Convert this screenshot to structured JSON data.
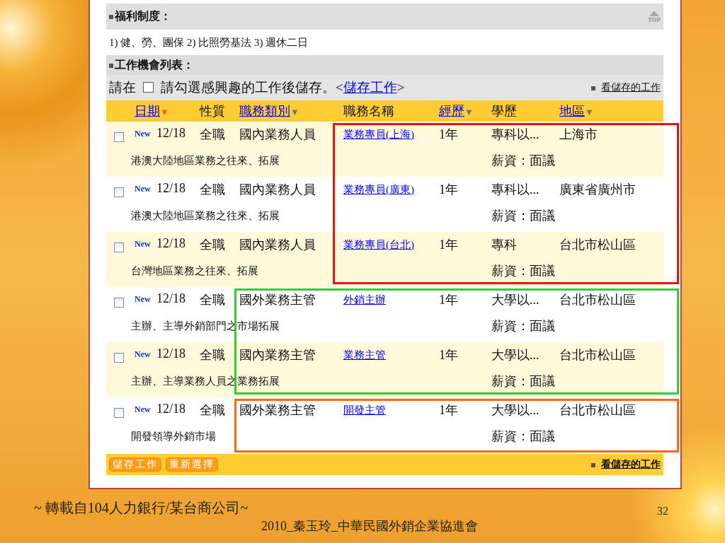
{
  "benefits": {
    "heading": "福利制度：",
    "text": "1) 健、勞、團保 2) 比照勞基法 3) 週休二日",
    "top_link": "TOP"
  },
  "jobs_heading": "工作機會列表：",
  "instruction": {
    "before": "請在",
    "checked": false,
    "after": "請勾選感興趣的工作後儲存。<",
    "link": "儲存工作",
    "end": ">",
    "saved_link": "看儲存的工作"
  },
  "columns": [
    {
      "label": "日期",
      "link": true,
      "arrow": "▼",
      "sorted": true
    },
    {
      "label": "性質",
      "link": false
    },
    {
      "label": "職務類別",
      "link": true,
      "arrow": "▼",
      "sorted": false
    },
    {
      "label": "職務名稱",
      "link": false
    },
    {
      "label": "經歷",
      "link": true,
      "arrow": "▼",
      "sorted": false
    },
    {
      "label": "學歷",
      "link": false
    },
    {
      "label": "地區",
      "link": true,
      "arrow": "▼",
      "sorted": false
    }
  ],
  "jobs": [
    {
      "checked": false,
      "badge": "New",
      "date": "12/18",
      "type": "全職",
      "category": "國內業務人員",
      "title": "業務專員(上海)",
      "experience": "1年",
      "education": "專科以...",
      "area": "上海市",
      "description": "港澳大陸地區業務之往來、拓展",
      "salary": "薪資：面議",
      "frame": {
        "color": "#ee1111",
        "kind": "narrow"
      }
    },
    {
      "checked": false,
      "badge": "New",
      "date": "12/18",
      "type": "全職",
      "category": "國內業務人員",
      "title": "業務專員(廣東)",
      "experience": "1年",
      "education": "專科以...",
      "area": "廣東省廣州市",
      "description": "港澳大陸地區業務之往來、拓展",
      "salary": "薪資：面議",
      "frame": {
        "color": "#ee1111",
        "kind": "narrow"
      }
    },
    {
      "checked": false,
      "badge": "New",
      "date": "12/18",
      "type": "全職",
      "category": "國內業務人員",
      "title": "業務專員(台北)",
      "experience": "1年",
      "education": "專科",
      "area": "台北市松山區",
      "description": "台灣地區業務之往來、拓展",
      "salary": "薪資：面議",
      "frame": {
        "color": "#ee1111",
        "kind": "narrow"
      }
    },
    {
      "checked": false,
      "badge": "New",
      "date": "12/18",
      "type": "全職",
      "category": "國外業務主管",
      "title": "外銷主辦",
      "experience": "1年",
      "education": "大學以...",
      "area": "台北市松山區",
      "description": "主辦、主導外銷部門之市場拓展",
      "salary": "薪資：面議",
      "frame": {
        "color": "#33cc33",
        "kind": "wide"
      }
    },
    {
      "checked": false,
      "badge": "New",
      "date": "12/18",
      "type": "全職",
      "category": "國內業務主管",
      "title": "業務主管",
      "experience": "1年",
      "education": "大學以...",
      "area": "台北市松山區",
      "description": "主辦、主導業務人員之業務拓展",
      "salary": "薪資：面議",
      "frame": {
        "color": "#33cc33",
        "kind": "wide"
      }
    },
    {
      "checked": false,
      "badge": "New",
      "date": "12/18",
      "type": "全職",
      "category": "國外業務主管",
      "title": "開發主管",
      "experience": "1年",
      "education": "大學以...",
      "area": "台北市松山區",
      "description": "開發領導外銷市場",
      "salary": "薪資：面議",
      "frame": {
        "color": "#ff6611",
        "kind": "wide"
      }
    }
  ],
  "footer": {
    "buttons": [
      "儲存工作",
      "重新選擇"
    ],
    "saved_link": "看儲存的工作"
  },
  "slide": {
    "source": "~ 轉載自104人力銀行/某台商公司~",
    "page_number": "32",
    "credit": "2010_秦玉玲_中華民國外銷企業協進會"
  }
}
